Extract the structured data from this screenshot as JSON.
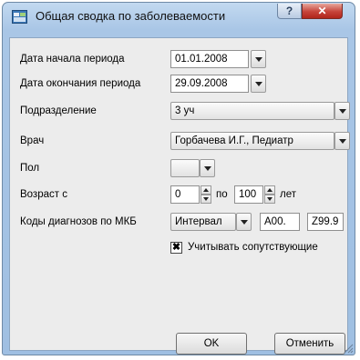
{
  "window": {
    "title": "Общая сводка по заболеваемости",
    "help_glyph": "?",
    "close_glyph": "✕"
  },
  "form": {
    "start_date": {
      "label": "Дата начала периода",
      "value": "01.01.2008"
    },
    "end_date": {
      "label": "Дата окончания периода",
      "value": "29.09.2008"
    },
    "department": {
      "label": "Подразделение",
      "value": "3 уч"
    },
    "doctor": {
      "label": "Врач",
      "value": "Горбачева И.Г., Педиатр"
    },
    "sex": {
      "label": "Пол",
      "value": ""
    },
    "age": {
      "label": "Возраст с",
      "from": "0",
      "to_label": "по",
      "to": "100",
      "unit": "лет"
    },
    "icd": {
      "label": "Коды диагнозов по МКБ",
      "mode": "Интервал",
      "from": "A00.",
      "to": "Z99.9"
    },
    "concomitant": {
      "label": "Учитывать сопутствующие",
      "checked": true,
      "mark": "✖"
    }
  },
  "buttons": {
    "ok": "OK",
    "cancel": "Отменить"
  }
}
